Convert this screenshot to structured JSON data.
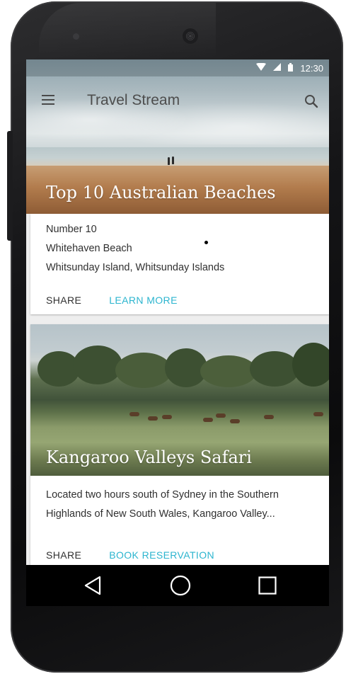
{
  "status_bar": {
    "time": "12:30",
    "icons": [
      "wifi-icon",
      "signal-icon",
      "battery-icon"
    ]
  },
  "app_bar": {
    "title": "Travel Stream",
    "menu_icon": "menu-icon",
    "search_icon": "search-icon"
  },
  "cards": [
    {
      "title": "Top 10 Australian Beaches",
      "lines": [
        "Number 10",
        "Whitehaven Beach",
        "Whitsunday Island, Whitsunday Islands"
      ],
      "actions": [
        "SHARE",
        "LEARN MORE"
      ]
    },
    {
      "title": "Kangaroo Valleys Safari",
      "lines": [
        "Located two hours south of Sydney in the Southern",
        "Highlands of New South Wales, Kangaroo Valley..."
      ],
      "actions": [
        "SHARE",
        "BOOK RESERVATION"
      ]
    }
  ],
  "nav_bar": {
    "buttons": [
      "back-icon",
      "home-icon",
      "recents-icon"
    ]
  },
  "colors": {
    "accent": "#2cb5cf",
    "toolbar_text": "#4d4d4d",
    "body_text": "#303030",
    "nav_background": "#000000"
  }
}
